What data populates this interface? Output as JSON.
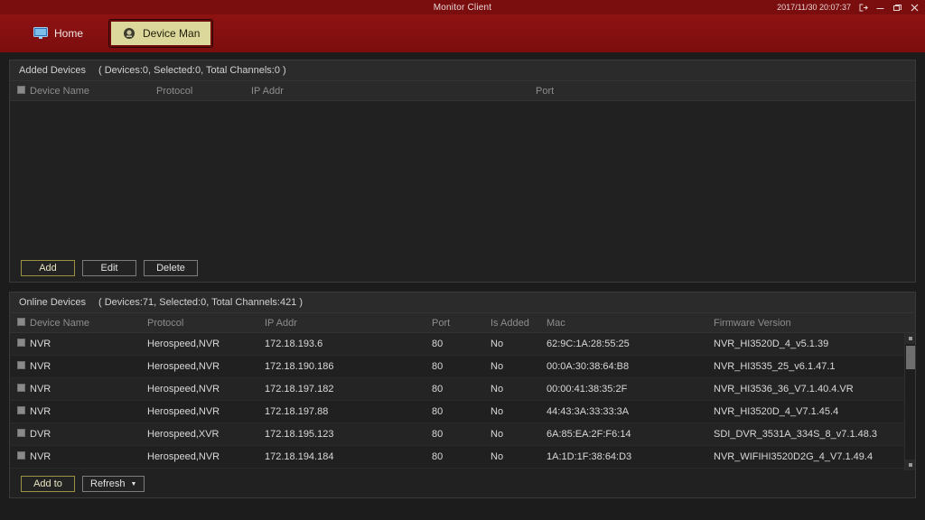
{
  "titlebar": {
    "title": "Monitor Client",
    "datetime": "2017/11/30 20:07:37",
    "logout_icon": "logout-icon",
    "minimize_icon": "minimize-icon",
    "restore_icon": "restore-icon",
    "close_icon": "close-icon"
  },
  "tabs": [
    {
      "label": "Home",
      "icon": "monitor-icon",
      "active": false
    },
    {
      "label": "Device Man",
      "icon": "camera-icon",
      "active": true
    }
  ],
  "added_devices": {
    "title": "Added Devices",
    "stats": "( Devices:0, Selected:0, Total Channels:0 )",
    "columns": [
      "Device Name",
      "Protocol",
      "IP Addr",
      "Port"
    ],
    "rows": [],
    "buttons": [
      {
        "label": "Add",
        "accent": true
      },
      {
        "label": "Edit",
        "accent": false
      },
      {
        "label": "Delete",
        "accent": false
      }
    ]
  },
  "online_devices": {
    "title": "Online Devices",
    "stats": "( Devices:71, Selected:0, Total Channels:421 )",
    "columns": [
      "Device Name",
      "Protocol",
      "IP Addr",
      "Port",
      "Is Added",
      "Mac",
      "Firmware Version"
    ],
    "rows": [
      {
        "device_name": "NVR",
        "protocol": "Herospeed,NVR",
        "ip_addr": "172.18.193.6",
        "port": "80",
        "is_added": "No",
        "mac": "62:9C:1A:28:55:25",
        "firmware": "NVR_HI3520D_4_v5.1.39"
      },
      {
        "device_name": "NVR",
        "protocol": "Herospeed,NVR",
        "ip_addr": "172.18.190.186",
        "port": "80",
        "is_added": "No",
        "mac": "00:0A:30:38:64:B8",
        "firmware": "NVR_HI3535_25_v6.1.47.1"
      },
      {
        "device_name": "NVR",
        "protocol": "Herospeed,NVR",
        "ip_addr": "172.18.197.182",
        "port": "80",
        "is_added": "No",
        "mac": "00:00:41:38:35:2F",
        "firmware": "NVR_HI3536_36_V7.1.40.4.VR"
      },
      {
        "device_name": "NVR",
        "protocol": "Herospeed,NVR",
        "ip_addr": "172.18.197.88",
        "port": "80",
        "is_added": "No",
        "mac": "44:43:3A:33:33:3A",
        "firmware": "NVR_HI3520D_4_V7.1.45.4"
      },
      {
        "device_name": "DVR",
        "protocol": "Herospeed,XVR",
        "ip_addr": "172.18.195.123",
        "port": "80",
        "is_added": "No",
        "mac": "6A:85:EA:2F:F6:14",
        "firmware": "SDI_DVR_3531A_334S_8_v7.1.48.3"
      },
      {
        "device_name": "NVR",
        "protocol": "Herospeed,NVR",
        "ip_addr": "172.18.194.184",
        "port": "80",
        "is_added": "No",
        "mac": "1A:1D:1F:38:64:D3",
        "firmware": "NVR_WIFIHI3520D2G_4_V7.1.49.4"
      }
    ],
    "buttons": [
      {
        "label": "Add to",
        "accent": true
      },
      {
        "label": "Refresh",
        "accent": false,
        "caret": "▼"
      }
    ]
  },
  "colors": {
    "titlebar_bg": "#7a0d0d",
    "tabstrip_bg": "#8c1111",
    "active_tab_bg": "#dcd79a",
    "accent_border": "#9b9240",
    "page_bg": "#1c1c1c"
  }
}
